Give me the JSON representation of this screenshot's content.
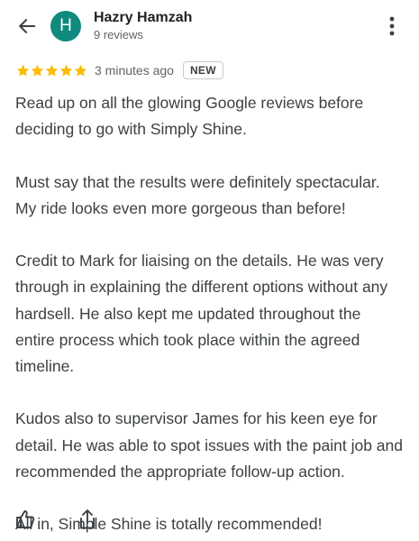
{
  "header": {
    "back_icon": "arrow-left-icon",
    "avatar_letter": "H",
    "avatar_color": "#0f8a7c",
    "author_name": "Hazry Hamzah",
    "review_count": "9 reviews",
    "more_icon": "more-vertical-icon"
  },
  "review": {
    "rating": 5,
    "star_color": "#fbbc04",
    "time_ago": "3 minutes ago",
    "badge": "NEW",
    "paragraphs": [
      "Read up on all the glowing Google reviews before deciding to go with Simply Shine.",
      "Must say that the results were definitely spectacular. My ride looks even more gorgeous than before!",
      "Credit to Mark for liaising on the details. He was very through in explaining the different options without any hardsell. He also kept me updated throughout the entire process which took place within the agreed timeline.",
      "Kudos also to supervisor James for his keen eye for detail. He was able to spot issues with the paint job and recommended the appropriate follow-up action.",
      "All in, Simple Shine is totally recommended!"
    ]
  },
  "actions": {
    "like_icon": "thumbs-up-icon",
    "share_icon": "share-icon"
  }
}
